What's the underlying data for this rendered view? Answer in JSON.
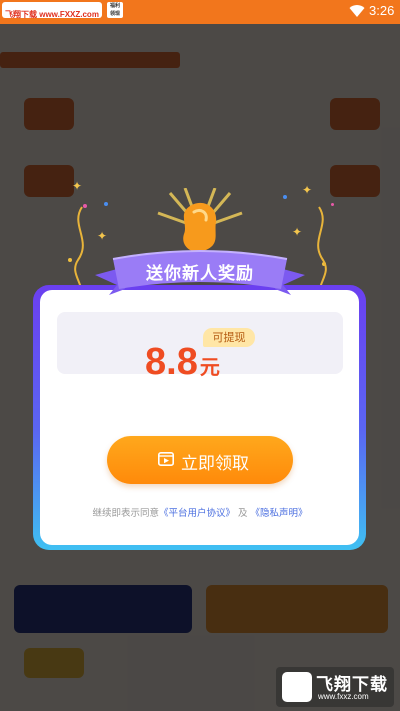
{
  "status_bar": {
    "site_label": "飞翔下载 www.FXXZ.com",
    "small_badge": "福利 领现",
    "time": "3:26"
  },
  "modal": {
    "banner_title": "送你新人奖励",
    "withdraw_tag": "可提现",
    "amount_value": "8.8",
    "amount_unit": "元",
    "claim_button": "立即领取",
    "agreement_prefix": "继续即表示同意",
    "user_agreement_link": "《平台用户协议》",
    "agreement_and": "及",
    "privacy_link": "《隐私声明》"
  },
  "watermark": {
    "brand": "飞翔下载",
    "url": "www.fxxz.com"
  },
  "colors": {
    "status_bar": "#f2761c",
    "amount": "#ef4c22",
    "button": "#ff9412",
    "link": "#4b6fe0",
    "frame_top": "#6b3ff0",
    "frame_bottom": "#3fc0f2"
  },
  "icons": [
    "wifi-icon",
    "battery-icon",
    "video-play-icon",
    "gold-bean-icon"
  ]
}
